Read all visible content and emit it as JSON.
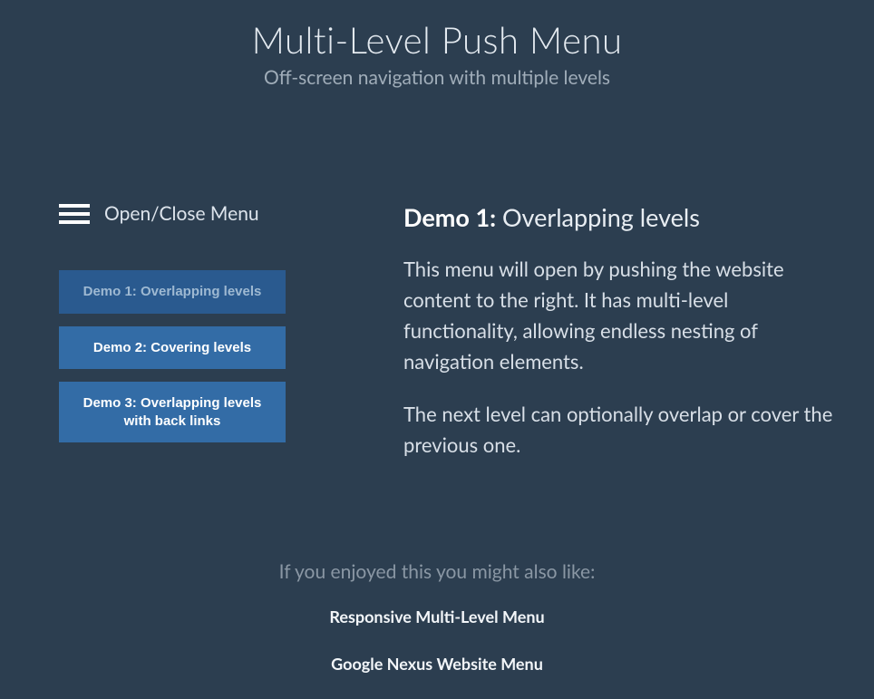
{
  "header": {
    "title": "Multi-Level Push Menu",
    "subtitle": "Off-screen navigation with multiple levels"
  },
  "menu_trigger": {
    "label": "Open/Close Menu"
  },
  "demos": [
    {
      "label": "Demo 1: Overlapping levels",
      "active": true
    },
    {
      "label": "Demo 2: Covering levels",
      "active": false
    },
    {
      "label": "Demo 3: Overlapping levels with back links",
      "active": false
    }
  ],
  "main": {
    "heading_strong": "Demo 1:",
    "heading_rest": " Overlapping levels",
    "paragraphs": [
      "This menu will open by pushing the website content to the right. It has multi-level functionality, allowing endless nesting of navigation elements.",
      "The next level can optionally overlap or cover the previous one."
    ]
  },
  "footer": {
    "intro": "If you enjoyed this you might also like:",
    "links": [
      "Responsive Multi-Level Menu",
      "Google Nexus Website Menu"
    ]
  }
}
